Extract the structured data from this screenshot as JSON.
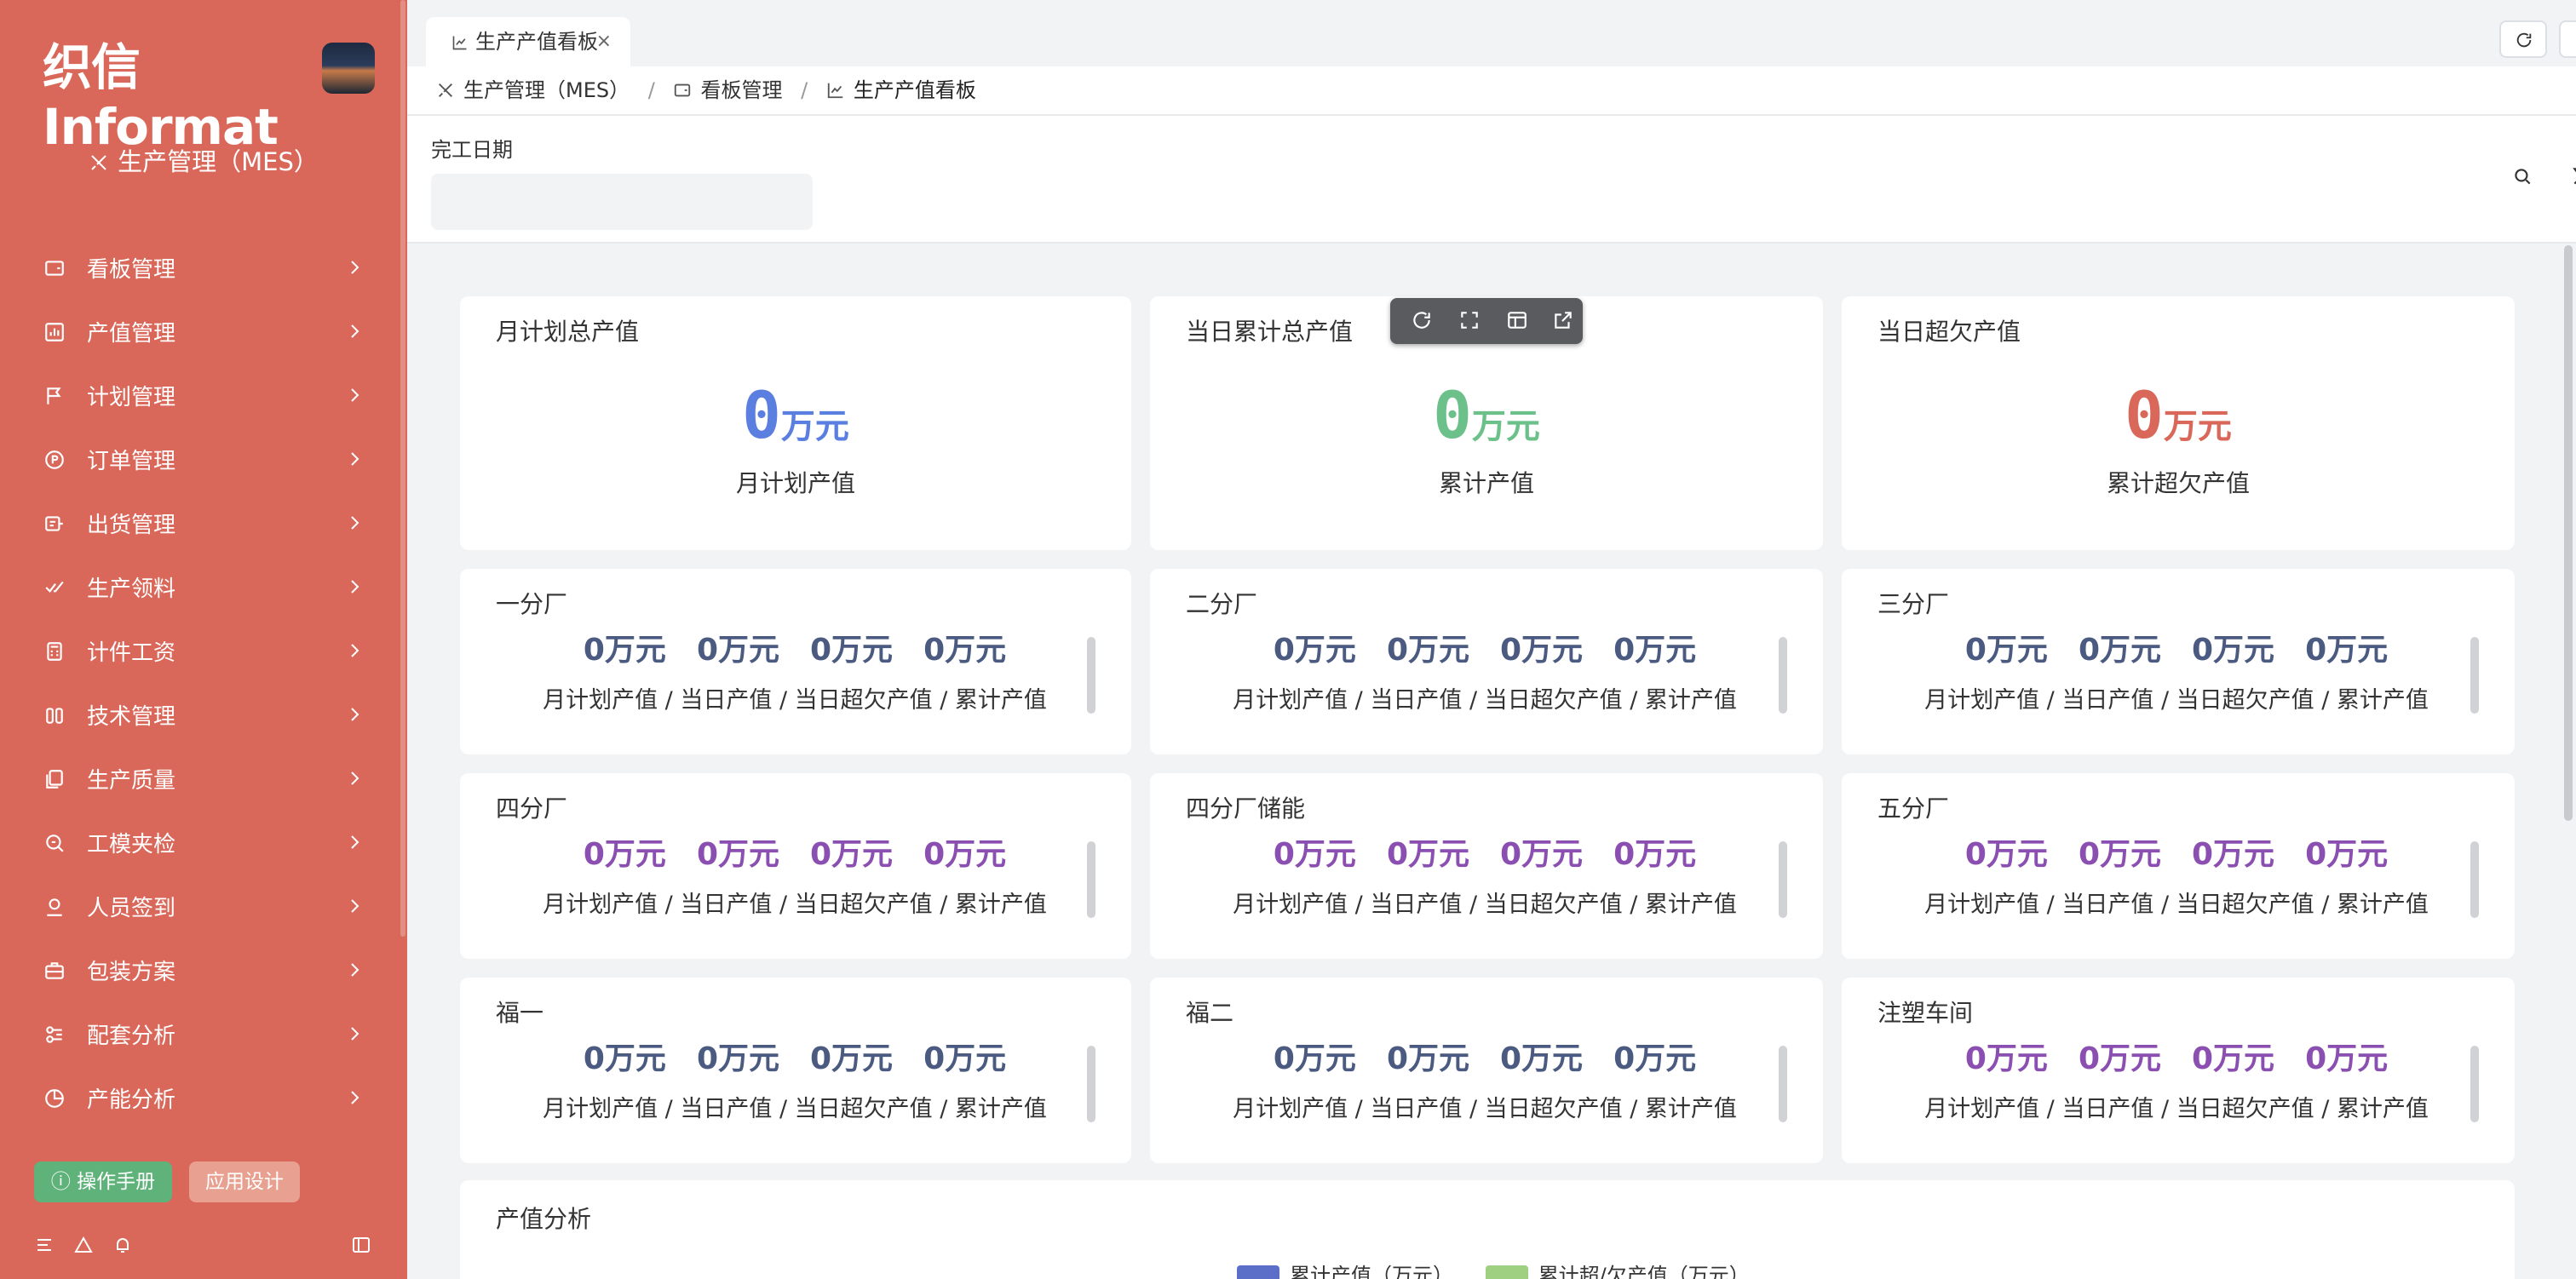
{
  "brand": {
    "logo": "织信 Informat"
  },
  "sidebar": {
    "app_name": "生产管理（MES）",
    "items": [
      {
        "label": "看板管理",
        "icon": "dashboard-icon"
      },
      {
        "label": "产值管理",
        "icon": "bar-chart-icon"
      },
      {
        "label": "计划管理",
        "icon": "flag-icon"
      },
      {
        "label": "订单管理",
        "icon": "order-icon"
      },
      {
        "label": "出货管理",
        "icon": "shipment-icon"
      },
      {
        "label": "生产领料",
        "icon": "check-icon"
      },
      {
        "label": "计件工资",
        "icon": "calculator-icon"
      },
      {
        "label": "技术管理",
        "icon": "tech-icon"
      },
      {
        "label": "生产质量",
        "icon": "quality-icon"
      },
      {
        "label": "工模夹检",
        "icon": "inspect-icon"
      },
      {
        "label": "人员签到",
        "icon": "user-icon"
      },
      {
        "label": "包装方案",
        "icon": "package-icon"
      },
      {
        "label": "配套分析",
        "icon": "network-icon"
      },
      {
        "label": "产能分析",
        "icon": "pie-icon"
      }
    ],
    "manual_btn": "操作手册",
    "design_btn": "应用设计"
  },
  "tabs": [
    {
      "label": "生产产值看板",
      "close": "×"
    }
  ],
  "breadcrumb": [
    {
      "label": "生产管理（MES）"
    },
    {
      "label": "看板管理"
    },
    {
      "label": "生产产值看板"
    }
  ],
  "breadcrumb_sep": "/",
  "filter": {
    "label": "完工日期",
    "value": "",
    "placeholder": ""
  },
  "summary": [
    {
      "title": "月计划总产值",
      "value": "0",
      "unit": "万元",
      "label": "月计划产值",
      "color": "#5b7fe0"
    },
    {
      "title": "当日累计总产值",
      "value": "0",
      "unit": "万元",
      "label": "累计产值",
      "color": "#6cc08a"
    },
    {
      "title": "当日超欠产值",
      "value": "0",
      "unit": "万元",
      "label": "累计超欠产值",
      "color": "#d9685a"
    }
  ],
  "caption": "月计划产值 / 当日产值 / 当日超欠产值 / 累计产值",
  "factories": [
    {
      "title": "一分厂",
      "values": [
        "0万元",
        "0万元",
        "0万元",
        "0万元"
      ],
      "color": "#4b5a80"
    },
    {
      "title": "二分厂",
      "values": [
        "0万元",
        "0万元",
        "0万元",
        "0万元"
      ],
      "color": "#4b5a80"
    },
    {
      "title": "三分厂",
      "values": [
        "0万元",
        "0万元",
        "0万元",
        "0万元"
      ],
      "color": "#4b5a80"
    },
    {
      "title": "四分厂",
      "values": [
        "0万元",
        "0万元",
        "0万元",
        "0万元"
      ],
      "color": "#8a4fb0"
    },
    {
      "title": "四分厂储能",
      "values": [
        "0万元",
        "0万元",
        "0万元",
        "0万元"
      ],
      "color": "#8a4fb0"
    },
    {
      "title": "五分厂",
      "values": [
        "0万元",
        "0万元",
        "0万元",
        "0万元"
      ],
      "color": "#8a4fb0"
    },
    {
      "title": "福一",
      "values": [
        "0万元",
        "0万元",
        "0万元",
        "0万元"
      ],
      "color": "#4b5a80"
    },
    {
      "title": "福二",
      "values": [
        "0万元",
        "0万元",
        "0万元",
        "0万元"
      ],
      "color": "#4b5a80"
    },
    {
      "title": "注塑车间",
      "values": [
        "0万元",
        "0万元",
        "0万元",
        "0万元"
      ],
      "color": "#8a4fb0"
    }
  ],
  "analysis": {
    "title": "产值分析",
    "legend": [
      {
        "label": "累计产值（万元）",
        "color": "#5b6fc8"
      },
      {
        "label": "累计超/欠产值（万元）",
        "color": "#9fcf80"
      }
    ]
  }
}
